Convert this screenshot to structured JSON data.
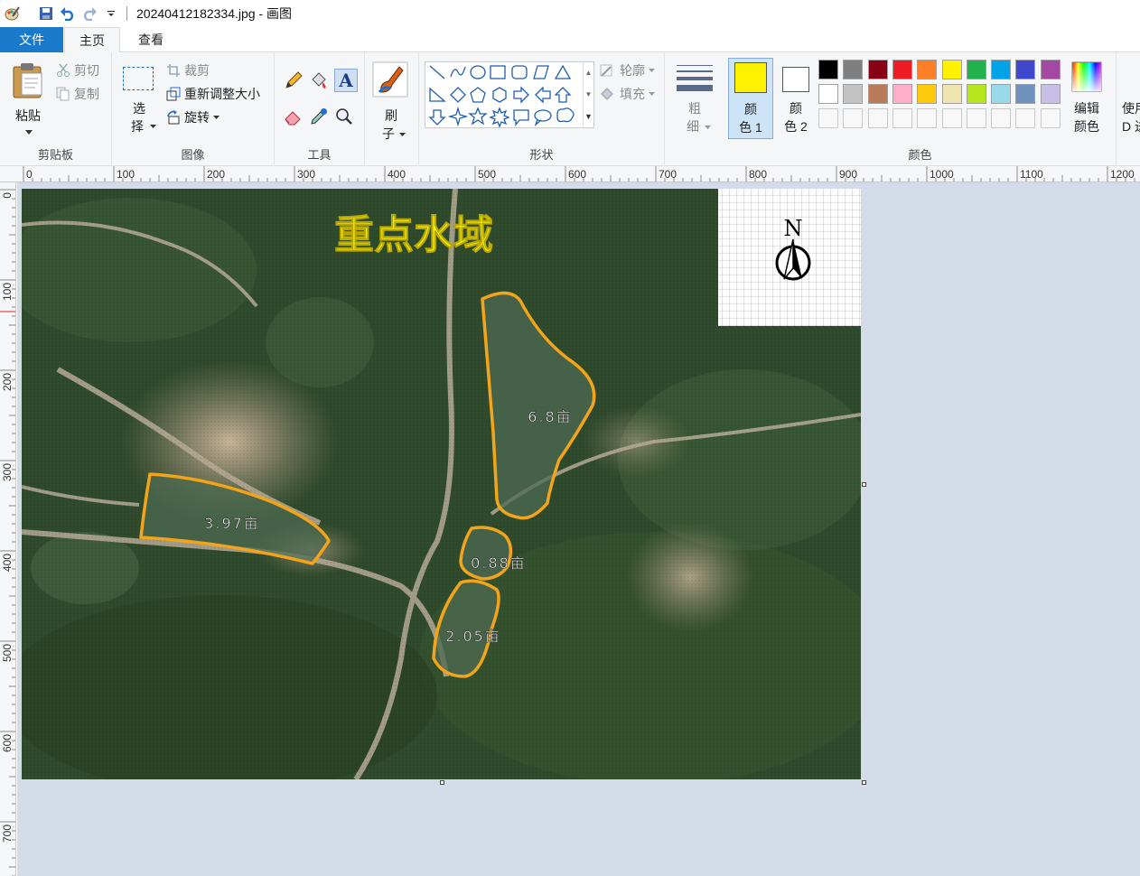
{
  "window": {
    "title": "20240412182334.jpg - 画图"
  },
  "tabs": {
    "file": "文件",
    "home": "主页",
    "view": "查看"
  },
  "clipboard": {
    "paste": "粘贴",
    "cut": "剪切",
    "copy": "复制",
    "group_label": "剪贴板"
  },
  "image_group": {
    "select_line1": "选",
    "select_line2": "择",
    "crop": "裁剪",
    "resize": "重新调整大小",
    "rotate": "旋转",
    "group_label": "图像"
  },
  "tools": {
    "group_label": "工具"
  },
  "brushes": {
    "label_line1": "刷",
    "label_line2": "子"
  },
  "shapes": {
    "outline": "轮廓",
    "fill": "填充",
    "group_label": "形状"
  },
  "size": {
    "label_line1": "粗",
    "label_line2": "细"
  },
  "colors": {
    "color1_line1": "颜",
    "color1_line2": "色 1",
    "color2_line1": "颜",
    "color2_line2": "色 2",
    "edit_line1": "编辑",
    "edit_line2": "颜色",
    "paint3d_line1": "使用",
    "paint3d_line2": "D 进",
    "group_label": "颜色",
    "color1_value": "#fff200",
    "color2_value": "#ffffff",
    "palette_row1": [
      "#000000",
      "#7f7f7f",
      "#880015",
      "#ed1c24",
      "#ff7f27",
      "#fff200",
      "#22b14c",
      "#00a2e8",
      "#3f48cc",
      "#a349a4"
    ],
    "palette_row2": [
      "#ffffff",
      "#c3c3c3",
      "#b97a57",
      "#ffaec9",
      "#ffc90e",
      "#efe4b0",
      "#b5e61d",
      "#99d9ea",
      "#7092be",
      "#c8bfe7"
    ]
  },
  "ruler": {
    "h_ticks": [
      "0",
      "100",
      "200",
      "300",
      "400",
      "500",
      "600",
      "700",
      "800",
      "900",
      "1000",
      "1100",
      "1200"
    ],
    "v_ticks": [
      "0",
      "100",
      "200",
      "300",
      "400",
      "500",
      "600",
      "700"
    ]
  },
  "image": {
    "title": "重点水域",
    "compass_letter": "N",
    "areas": [
      "6.8亩",
      "3.97亩",
      "0.88亩",
      "2.05亩"
    ]
  }
}
